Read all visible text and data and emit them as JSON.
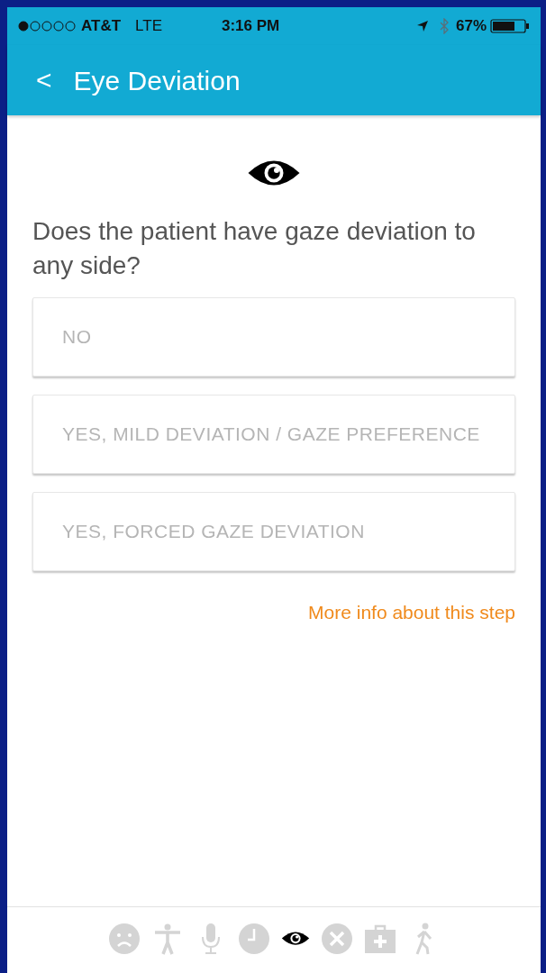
{
  "status_bar": {
    "carrier": "AT&T",
    "network": "LTE",
    "time": "3:16 PM",
    "battery": "67%"
  },
  "header": {
    "back": "<",
    "title": "Eye Deviation"
  },
  "question": "Does the patient have gaze deviation to any side?",
  "options": [
    {
      "label": "NO"
    },
    {
      "label": "YES, MILD DEVIATION / GAZE PREFERENCE"
    },
    {
      "label": "YES, FORCED GAZE DEVIATION"
    }
  ],
  "more_info_link": "More info about this step",
  "steps": [
    {
      "kind": "sad",
      "selected": false
    },
    {
      "kind": "body",
      "selected": false
    },
    {
      "kind": "mic",
      "selected": false
    },
    {
      "kind": "clock",
      "selected": false
    },
    {
      "kind": "eye",
      "selected": true
    },
    {
      "kind": "cross",
      "selected": false
    },
    {
      "kind": "medkit",
      "selected": false
    },
    {
      "kind": "walk",
      "selected": false
    }
  ]
}
